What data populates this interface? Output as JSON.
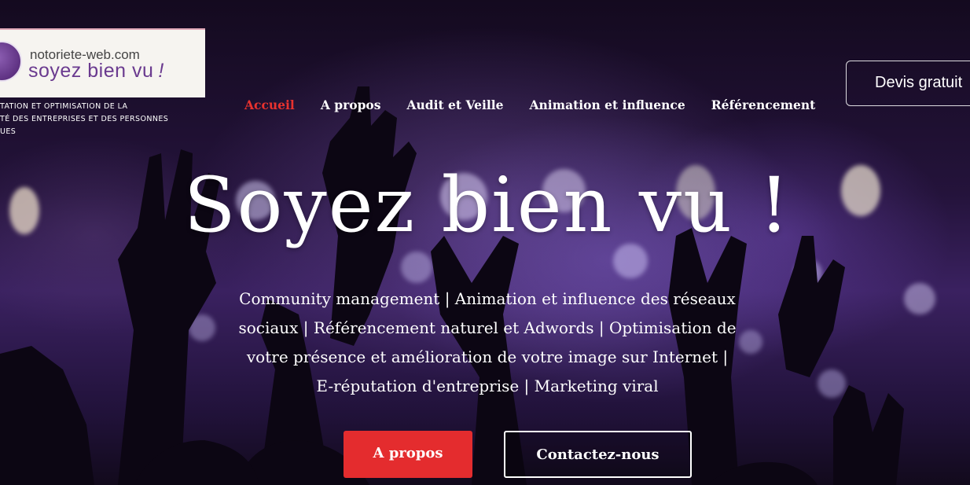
{
  "brand": {
    "domain": "notoriete-web.com",
    "slogan": "soyez bien vu",
    "slogan_mark": "!",
    "tagline_lines": [
      "TATION ET OPTIMISATION DE LA",
      "TÉ DES ENTREPRISES ET DES PERSONNES",
      "UES"
    ]
  },
  "nav": {
    "items": [
      "Accueil",
      "A propos",
      "Audit et Veille",
      "Animation et influence",
      "Référencement"
    ],
    "active_index": 0
  },
  "header": {
    "cta_label": "Devis gratuit"
  },
  "hero": {
    "title": "Soyez bien vu !",
    "subtitle_lines": [
      "Community management | Animation et influence des réseaux",
      "sociaux | Référencement naturel et Adwords | Optimisation de",
      "votre présence et amélioration de votre image sur Internet |",
      "E-réputation d'entreprise | Marketing viral"
    ],
    "primary_button": "A propos",
    "secondary_button": "Contactez-nous"
  },
  "colors": {
    "accent": "#e42c2e",
    "nav_active": "#e8322e",
    "brand_purple": "#6a3a8f"
  },
  "icons": [
    "logo-emblem-icon"
  ]
}
